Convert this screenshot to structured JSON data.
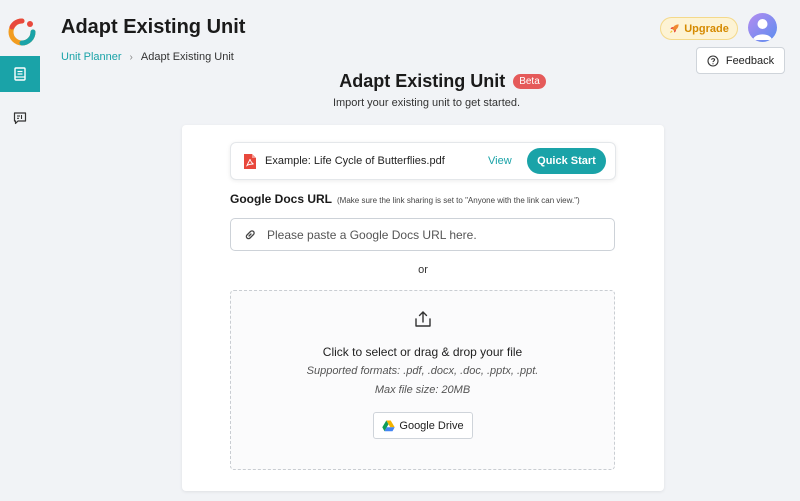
{
  "header": {
    "title": "Adapt Existing Unit",
    "breadcrumb": {
      "parent": "Unit Planner",
      "current": "Adapt Existing Unit"
    },
    "upgrade_label": "Upgrade",
    "feedback_label": "Feedback"
  },
  "main": {
    "title": "Adapt Existing Unit",
    "badge": "Beta",
    "subtitle": "Import your existing unit to get started."
  },
  "example": {
    "file_label": "Example: Life Cycle of Butterflies.pdf",
    "view_label": "View",
    "quick_start_label": "Quick Start"
  },
  "gdocs": {
    "label": "Google Docs URL",
    "hint": "(Make sure the link sharing is set to \"Anyone with the link can view.\")",
    "placeholder": "Please paste a Google Docs URL here.",
    "value": ""
  },
  "or_label": "or",
  "dropzone": {
    "main_text": "Click to select or drag & drop your file",
    "formats_text": "Supported formats: .pdf, .docx, .doc, .pptx, .ppt.",
    "size_text": "Max file size: 20MB",
    "gdrive_label": "Google Drive"
  },
  "colors": {
    "accent": "#1aa3a8",
    "beta": "#e55a5a",
    "upgrade_text": "#d58a00",
    "background": "#f1f3f6"
  },
  "icons": {
    "logo": "app-logo",
    "nav_1": "book-icon",
    "nav_2": "chat-icon",
    "upgrade": "rocket-icon",
    "feedback": "question-icon",
    "file": "pdf-icon",
    "url": "link-icon",
    "upload": "upload-icon",
    "gdrive": "google-drive-icon"
  }
}
